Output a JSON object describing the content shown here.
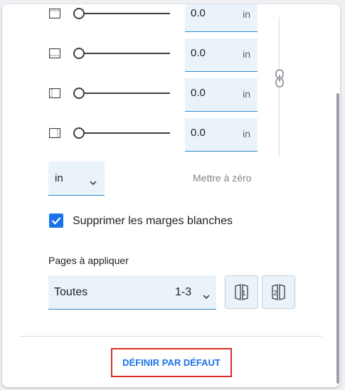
{
  "margins": {
    "rows": [
      {
        "side": "top",
        "icon": "margin-top-icon",
        "value": "0.0",
        "unit": "in"
      },
      {
        "side": "bottom",
        "icon": "margin-bottom-icon",
        "value": "0.0",
        "unit": "in"
      },
      {
        "side": "left",
        "icon": "margin-left-icon",
        "value": "0.0",
        "unit": "in"
      },
      {
        "side": "right",
        "icon": "margin-right-icon",
        "value": "0.0",
        "unit": "in"
      }
    ],
    "slider_level": 0,
    "link_icon": "link-icon"
  },
  "unit_select": {
    "value": "in"
  },
  "reset_label": "Mettre à zéro",
  "whitespace_checkbox": {
    "label": "Supprimer les marges blanches",
    "checked": true
  },
  "pages": {
    "title": "Pages à appliquer",
    "select_value": "Toutes",
    "range": "1-3",
    "buttons": [
      "odd-pages-icon",
      "even-pages-icon"
    ]
  },
  "default_button": {
    "label": "DÉFINIR PAR DÉFAUT"
  },
  "colors": {
    "accent": "#1a73e8",
    "field_bg": "#eaf3fa",
    "highlight": "#d93025"
  }
}
